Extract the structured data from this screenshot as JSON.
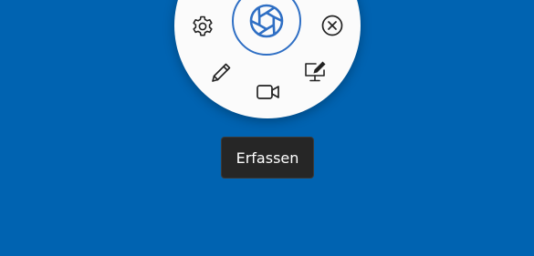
{
  "radial_menu": {
    "center_action": {
      "icon": "camera-shutter-icon",
      "color": "#2f6fc4"
    },
    "items": [
      {
        "name": "settings",
        "icon": "gear-icon"
      },
      {
        "name": "close",
        "icon": "close-circle-icon"
      },
      {
        "name": "pen",
        "icon": "pencil-icon"
      },
      {
        "name": "screen-annotate",
        "icon": "monitor-pen-icon"
      },
      {
        "name": "record-video",
        "icon": "video-camera-icon"
      }
    ]
  },
  "tooltip": {
    "text": "Erfassen"
  },
  "colors": {
    "background": "#0063b1",
    "menu_surface": "#fbfbfb",
    "accent": "#2f6fc4",
    "tooltip_bg": "#262626",
    "icon": "#222222"
  }
}
